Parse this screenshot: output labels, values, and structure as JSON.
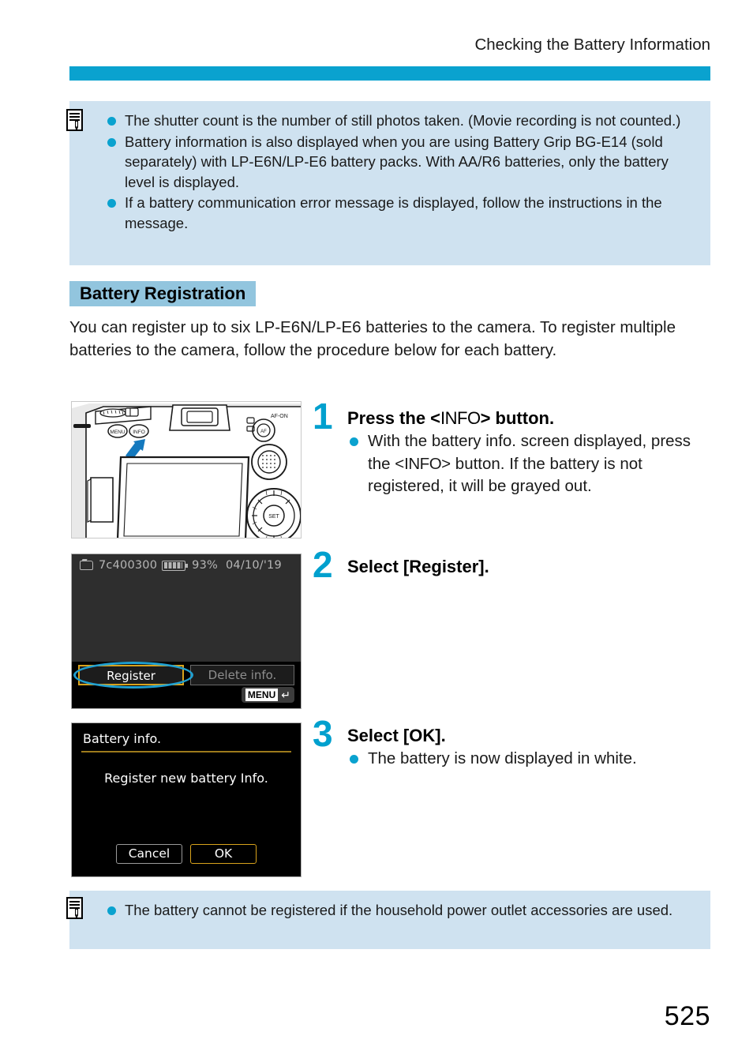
{
  "header": {
    "running_title": "Checking the Battery Information"
  },
  "top_note": {
    "icon": "note-document-pen-icon",
    "items": [
      "The shutter count is the number of still photos taken. (Movie recording is not counted.)",
      "Battery information is also displayed when you are using Battery Grip BG-E14 (sold separately) with LP-E6N/LP-E6 battery packs. With AA/R6 batteries, only the battery level is displayed.",
      "If a battery communication error message is displayed, follow the instructions in the message."
    ]
  },
  "section": {
    "heading": "Battery Registration",
    "intro": "You can register up to six LP-E6N/LP-E6 batteries to the camera. To register multiple batteries to the camera, follow the procedure below for each battery."
  },
  "steps": [
    {
      "number": "1",
      "title_pre": "Press the <",
      "title_glyph": "INFO",
      "title_post": "> button.",
      "bullets": [
        {
          "pre": "With the battery info. screen displayed, press the <",
          "glyph": "INFO",
          "post": "> button. If the battery is not registered, it will be grayed out."
        }
      ]
    },
    {
      "number": "2",
      "title": "Select [Register].",
      "bullets": []
    },
    {
      "number": "3",
      "title": "Select [OK].",
      "bullets": [
        {
          "text": "The battery is now displayed in white."
        }
      ]
    }
  ],
  "figures": {
    "camera": {
      "name": "camera-rear-illustration",
      "labels": {
        "af_on": "AF-ON",
        "menu_button": "MENU",
        "info_button": "INFO",
        "set_button": "SET"
      }
    },
    "battery_info_screen": {
      "serial": "7c400300",
      "battery_icon": "battery-full-icon",
      "camera_icon": "camera-icon",
      "percent": "93%",
      "date": "04/10/'19",
      "buttons": [
        {
          "label": "Register",
          "selected": true
        },
        {
          "label": "Delete info.",
          "selected": false
        }
      ],
      "menu_badge": {
        "label": "MENU",
        "arrow": "return-arrow-icon"
      }
    },
    "register_dialog": {
      "title": "Battery info.",
      "message": "Register new battery Info.",
      "buttons": [
        {
          "label": "Cancel",
          "selected": false
        },
        {
          "label": "OK",
          "selected": true
        }
      ]
    }
  },
  "bottom_note": {
    "icon": "note-document-pen-icon",
    "items": [
      "The battery cannot be registered if the household power outlet accessories are used."
    ]
  },
  "footer": {
    "page_number": "525"
  },
  "colors": {
    "accent_blue": "#0aa2cf",
    "heading_highlight": "#92c5de",
    "note_background": "#cfe2f0",
    "step_number": "#00a0ce",
    "selection_gold": "#d8a21c",
    "highlight_ring": "#1f9fd0"
  }
}
